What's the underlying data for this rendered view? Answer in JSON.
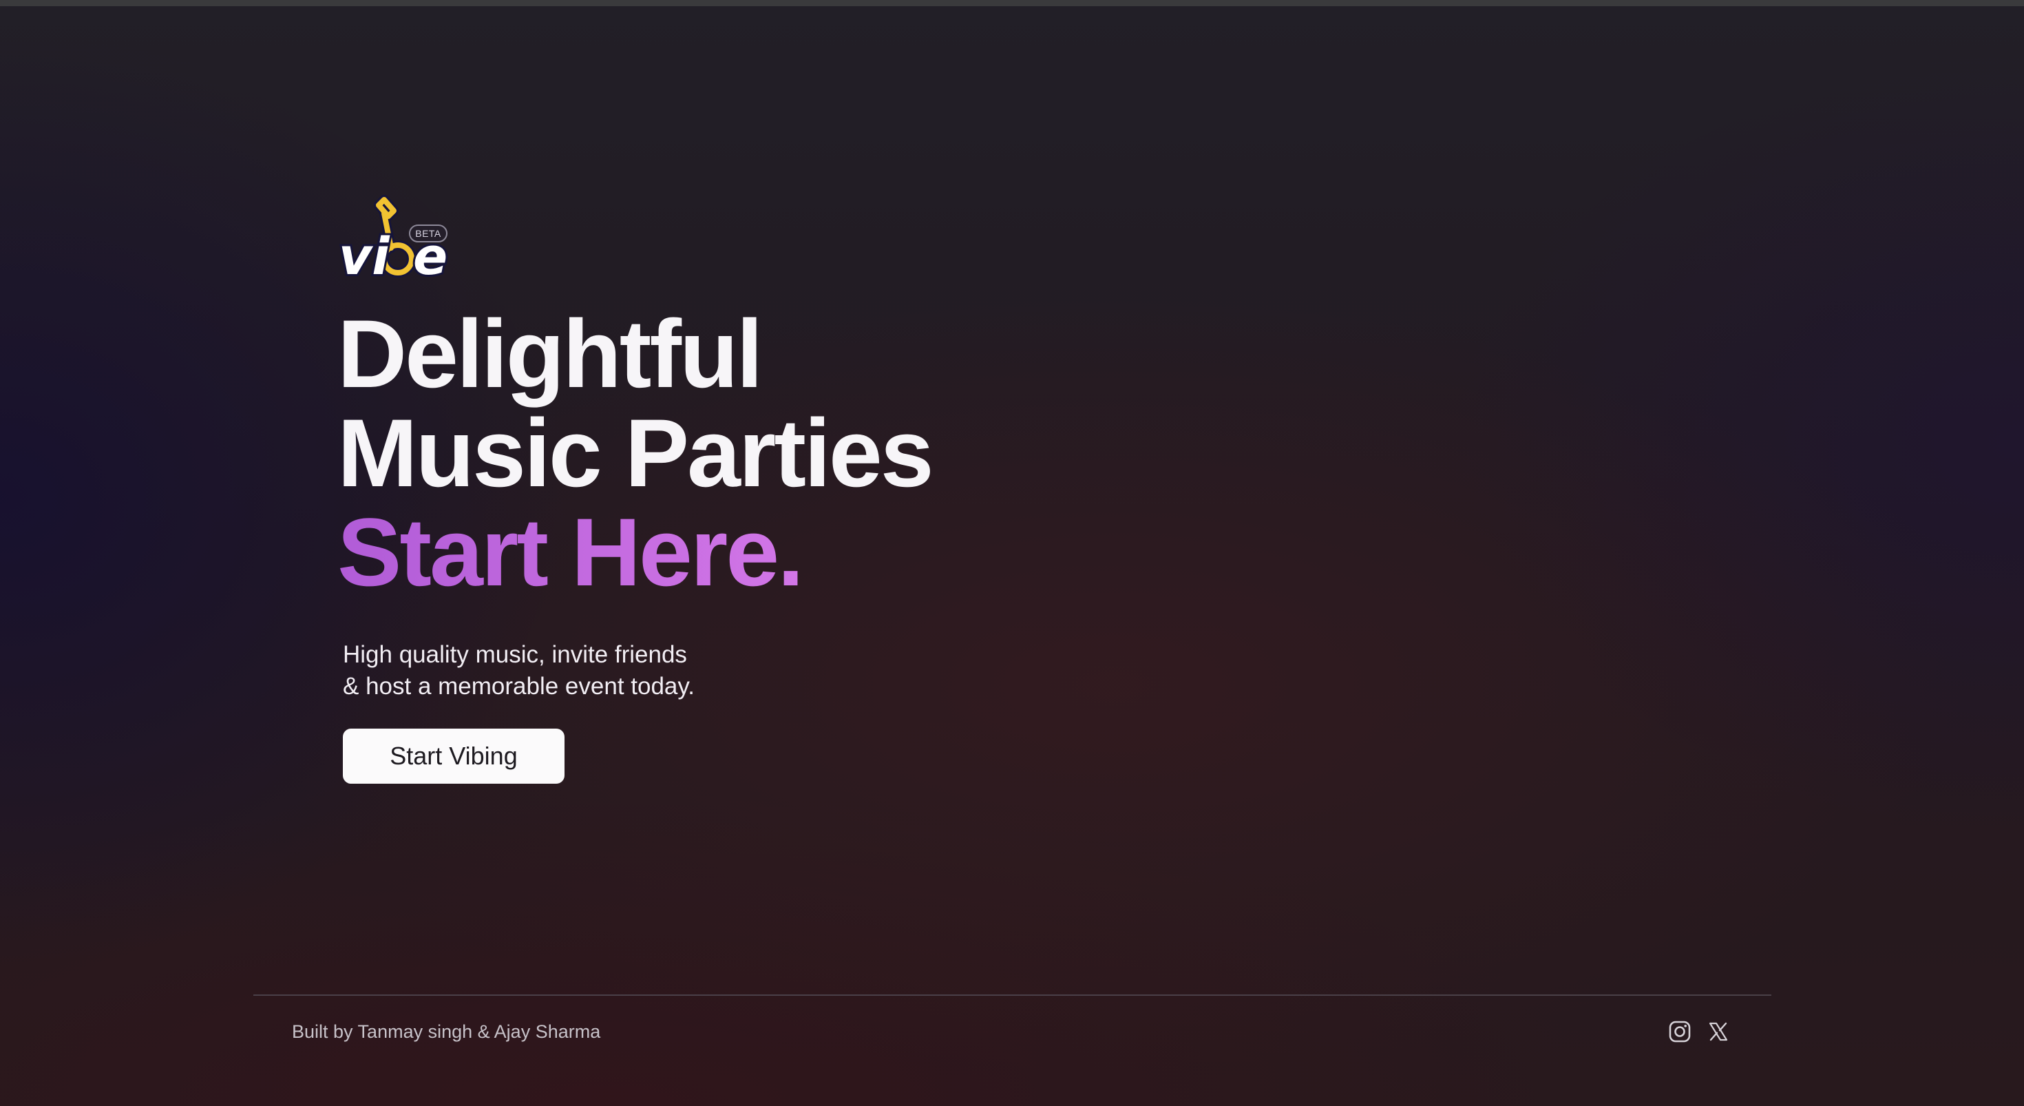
{
  "brand": {
    "logo_text": "vibe",
    "badge": "BETA",
    "logo_colors": {
      "note": "#f1c232",
      "text": "#ffffff",
      "outline": "#15143a"
    }
  },
  "hero": {
    "headline_line1": "Delightful",
    "headline_line2": "Music Parties",
    "headline_accent": "Start Here.",
    "subtext_line1": "High quality music, invite friends",
    "subtext_line2": "& host a memorable event today.",
    "cta_label": "Start Vibing"
  },
  "footer": {
    "credit": "Built by Tanmay singh & Ajay Sharma",
    "social": [
      {
        "icon": "instagram-icon"
      },
      {
        "icon": "x-twitter-icon"
      }
    ]
  },
  "colors": {
    "accent_gradient_start": "#b15cd7",
    "accent_gradient_end": "#e08af0",
    "background": "#231a22",
    "button_bg": "#fbfafb"
  }
}
